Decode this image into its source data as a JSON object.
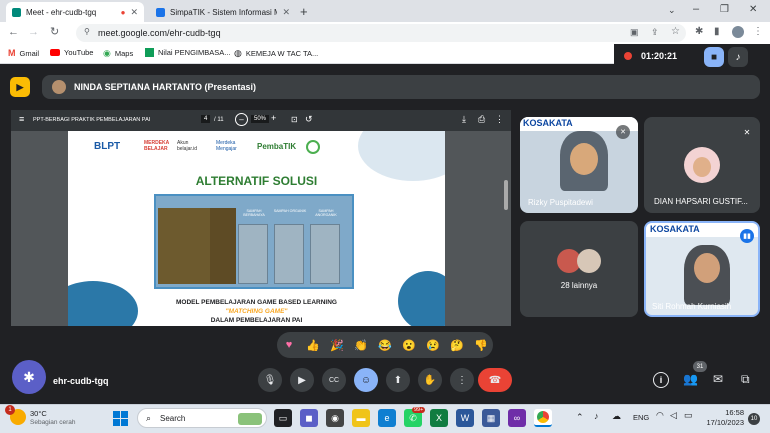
{
  "tabs": [
    {
      "title": "Meet - ehr-cudb-tgq",
      "active": true
    },
    {
      "title": "SimpaTIK - Sistem Informasi Ma",
      "active": false
    }
  ],
  "address": {
    "url": "meet.google.com/ehr-cudb-tgq"
  },
  "bookmarks": [
    "Gmail",
    "YouTube",
    "Maps",
    "Nilai PENGIMBASA...",
    "KEMEJA W TAC TA..."
  ],
  "recording": {
    "time": "01:20:21"
  },
  "presenter_banner": {
    "text": "NINDA SEPTIANA HARTANTO (Presentasi)"
  },
  "pdf": {
    "filename": "PPT-BERBAGI PRAKTIK PEMBELAJARAN PAI",
    "page": "4",
    "total": "/ 11",
    "zoom": "50%"
  },
  "slide": {
    "logos": [
      "BLPT",
      "MERDEKA BELAJAR",
      "Akun belajar.id",
      "Merdeka Mengajar",
      "PembaTIK"
    ],
    "title": "ALTERNATIF SOLUSI",
    "game_labels": [
      "SAMPAH BERBAHAYA",
      "SAMPAH ORGANIK",
      "SAMPAH ANORGANIK"
    ],
    "model_text": "MODEL PEMBELAJARAN GAME BASED LEARNING",
    "matching_text": "\"MATCHING GAME\"",
    "dalam_text": "DALAM PEMBELAJARAN PAI"
  },
  "participants": [
    {
      "name": "Rizky Puspitadewi",
      "banner": "KOSAKATA"
    },
    {
      "name": "DIAN HAPSARI GUSTIF..."
    },
    {
      "name": "28 lainnya"
    },
    {
      "name": "Siti Rohmah Kurniasih",
      "banner": "KOSAKATA"
    }
  ],
  "reactions": [
    "sparkle-heart",
    "thumbs-up",
    "party",
    "clap",
    "joy",
    "surprised",
    "sad",
    "thinking",
    "thumbs-down"
  ],
  "meeting_code": "ehr-cudb-tgq",
  "people_count": "31",
  "taskbar": {
    "weather_temp": "30°C",
    "weather_desc": "Sebagian cerah",
    "weather_badge": "1",
    "search": "Search",
    "whatsapp_badge": "99+",
    "lang": "ENG",
    "time": "16:58",
    "date": "17/10/2023",
    "notif": "10"
  },
  "colors": {
    "meet_bg": "#202124",
    "tile": "#3c4043",
    "accent": "#8ab4f8",
    "end_call": "#ea4335",
    "rec": "#ea4335"
  }
}
